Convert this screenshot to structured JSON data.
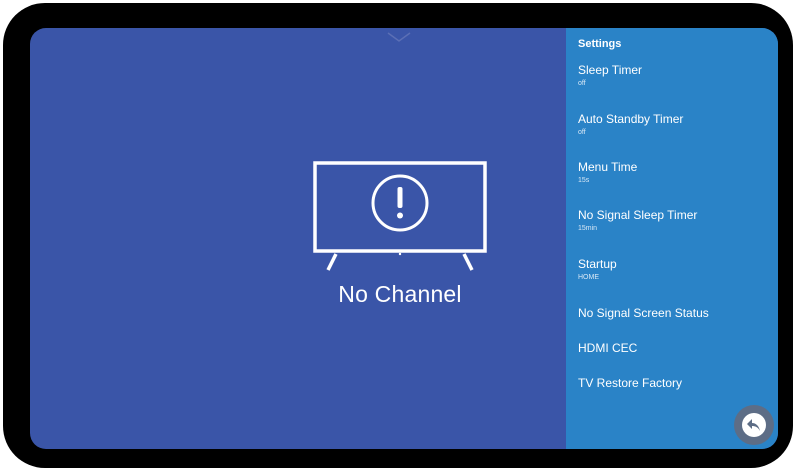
{
  "screen": {
    "status_message": "No Channel",
    "background_color": "#3a55a8"
  },
  "settings": {
    "title": "Settings",
    "panel_color": "#2a83c7",
    "items": [
      {
        "label": "Sleep Timer",
        "value": "off"
      },
      {
        "label": "Auto Standby Timer",
        "value": "off"
      },
      {
        "label": "Menu Time",
        "value": "15s"
      },
      {
        "label": "No Signal Sleep Timer",
        "value": "15min"
      },
      {
        "label": "Startup",
        "value": "HOME"
      },
      {
        "label": "No Signal Screen Status",
        "value": ""
      },
      {
        "label": "HDMI CEC",
        "value": ""
      },
      {
        "label": "TV Restore Factory",
        "value": ""
      }
    ]
  },
  "icons": {
    "top": "chevron-down-icon",
    "center": "tv-warning-icon",
    "back": "back-arrow-icon"
  }
}
